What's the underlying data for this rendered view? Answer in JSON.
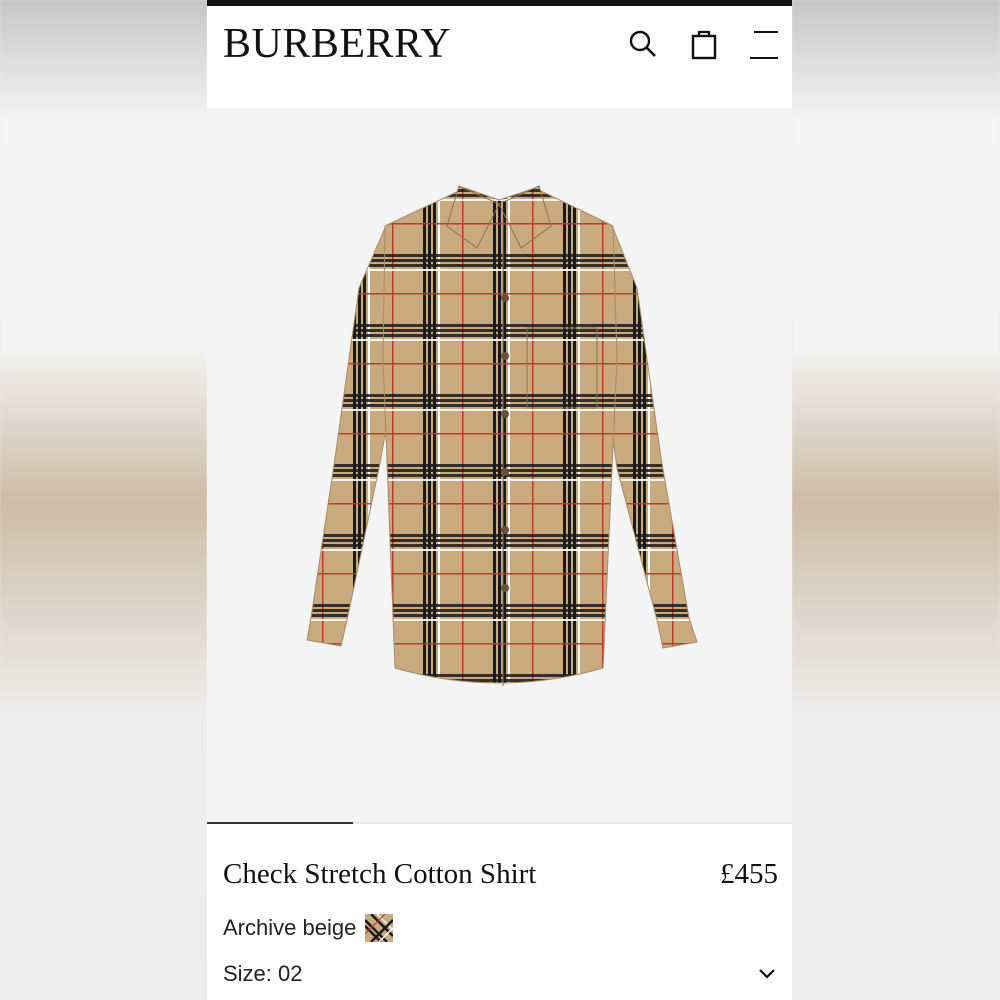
{
  "brand": {
    "logo": "BURBERRY"
  },
  "header": {
    "icons": [
      "search-icon",
      "bag-icon",
      "menu-icon"
    ]
  },
  "breadcrumb": {
    "text": ""
  },
  "product": {
    "name": "Check Stretch Cotton Shirt",
    "price": "£455",
    "colour": "Archive beige",
    "size": "Size: 02",
    "image_progress": 0.25
  },
  "colors": {
    "beige": "#c9a97e",
    "black": "#1a1a1a",
    "red": "#c0392b",
    "white": "#ffffff"
  }
}
